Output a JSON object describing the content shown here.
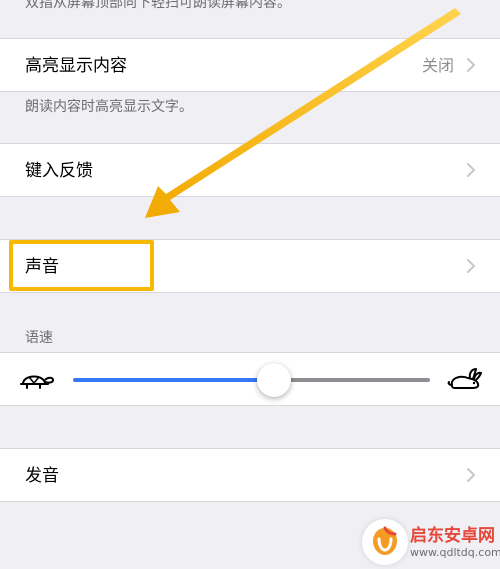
{
  "top_footnote": "双指从屏幕顶部向下轻扫可朗读屏幕内容。",
  "highlight_content": {
    "label": "高亮显示内容",
    "value": "关闭",
    "footnote": "朗读内容时高亮显示文字。"
  },
  "typing_feedback": {
    "label": "键入反馈"
  },
  "sounds": {
    "label": "声音"
  },
  "speaking_rate": {
    "header": "语速",
    "value_percent": 57
  },
  "pronunciations": {
    "label": "发音"
  },
  "watermark": {
    "name": "启东安卓网",
    "url": "www.qdltdq.com"
  },
  "colors": {
    "accent": "#3478f6",
    "highlight_box": "#f6b800",
    "arrow": "#f6b800"
  }
}
